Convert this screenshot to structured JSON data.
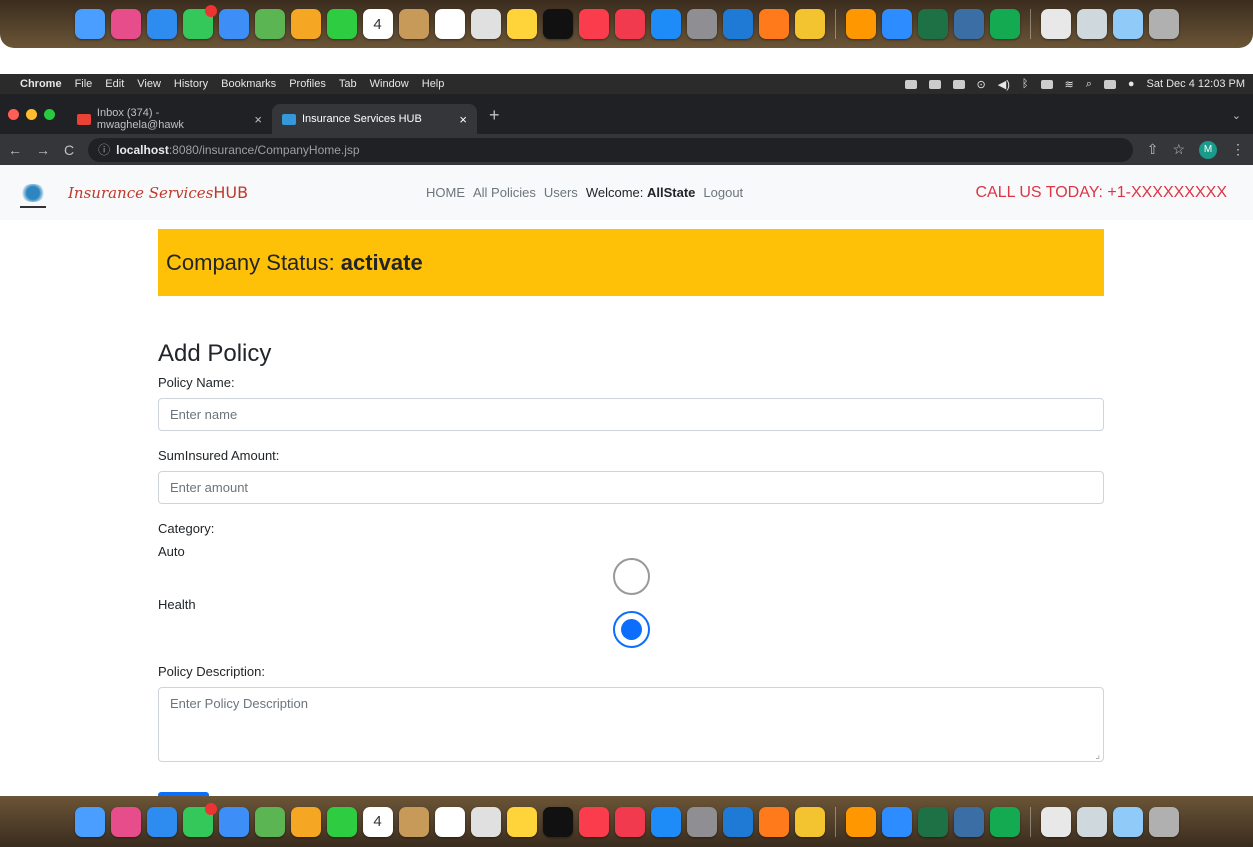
{
  "dock": {
    "icons": [
      {
        "name": "finder-icon",
        "color": "#4a9eff"
      },
      {
        "name": "launchpad-icon",
        "color": "#e74c8b"
      },
      {
        "name": "safari-icon",
        "color": "#2e8bf0"
      },
      {
        "name": "messages-icon",
        "color": "#34c759",
        "badge": true
      },
      {
        "name": "mail-icon",
        "color": "#3d8ef7"
      },
      {
        "name": "maps-icon",
        "color": "#5ab552"
      },
      {
        "name": "photos-icon",
        "color": "#f5a623"
      },
      {
        "name": "facetime-icon",
        "color": "#2ecc40"
      },
      {
        "name": "calendar-icon",
        "color": "#ffffff"
      },
      {
        "name": "contacts-icon",
        "color": "#c79a5a"
      },
      {
        "name": "reminders-icon",
        "color": "#ffffff"
      },
      {
        "name": "screenshot-icon",
        "color": "#e0e0e0"
      },
      {
        "name": "notes-icon",
        "color": "#ffd43b"
      },
      {
        "name": "appletv-icon",
        "color": "#111111"
      },
      {
        "name": "music-icon",
        "color": "#fa3c4c"
      },
      {
        "name": "news-icon",
        "color": "#f23a4e"
      },
      {
        "name": "appstore-icon",
        "color": "#1d8cf8"
      },
      {
        "name": "settings-icon",
        "color": "#8e8e93"
      },
      {
        "name": "vscode-icon",
        "color": "#1f7ad6"
      },
      {
        "name": "firefox-icon",
        "color": "#ff7a1a"
      },
      {
        "name": "chrome-icon",
        "color": "#f4c430"
      },
      {
        "name": "sublime-icon",
        "color": "#ff9800"
      },
      {
        "name": "zoom-icon",
        "color": "#2d8cff"
      },
      {
        "name": "excel-icon",
        "color": "#1e7145"
      },
      {
        "name": "mysql-workbench-icon",
        "color": "#3a6ea5"
      },
      {
        "name": "mongodb-icon",
        "color": "#13aa52"
      },
      {
        "name": "preview-icon",
        "color": "#e8e8e8"
      },
      {
        "name": "folder-icon",
        "color": "#cfd8dc"
      },
      {
        "name": "window-icon",
        "color": "#90caf9"
      },
      {
        "name": "trash-icon",
        "color": "#b0b0b0"
      }
    ],
    "calendar_day": "4"
  },
  "menubar": {
    "app": "Chrome",
    "items": [
      "File",
      "Edit",
      "View",
      "History",
      "Bookmarks",
      "Profiles",
      "Tab",
      "Window",
      "Help"
    ],
    "datetime": "Sat Dec 4  12:03 PM"
  },
  "tabs": [
    {
      "label": "Inbox (374) - mwaghela@hawk",
      "favicon": "gmail-icon",
      "active": false
    },
    {
      "label": "Insurance Services HUB",
      "favicon": "site-favicon-icon",
      "active": true
    }
  ],
  "address": {
    "host": "localhost",
    "path": ":8080/insurance/CompanyHome.jsp",
    "profile_initial": "M"
  },
  "navbar": {
    "brand_script": "Insurance Services",
    "brand_hub": "HUB",
    "links": [
      "HOME",
      "All Policies",
      "Users"
    ],
    "welcome_label": "Welcome:",
    "welcome_user": "AllState",
    "logout": "Logout",
    "callus": "CALL US TODAY: +1-XXXXXXXXX"
  },
  "status": {
    "label": "Company Status:",
    "value": "activate"
  },
  "form": {
    "title": "Add Policy",
    "policy_name_label": "Policy Name:",
    "policy_name_placeholder": "Enter name",
    "sum_label": "SumInsured Amount:",
    "sum_placeholder": "Enter amount",
    "category_label": "Category:",
    "categories": [
      {
        "label": "Auto",
        "checked": false
      },
      {
        "label": "Health",
        "checked": true
      }
    ],
    "description_label": "Policy Description:",
    "description_placeholder": "Enter Policy Description"
  },
  "colors": {
    "status_bg": "#ffc107",
    "brand_red": "#c0392b",
    "callus_red": "#dc3545",
    "radio_blue": "#0d6efd"
  }
}
